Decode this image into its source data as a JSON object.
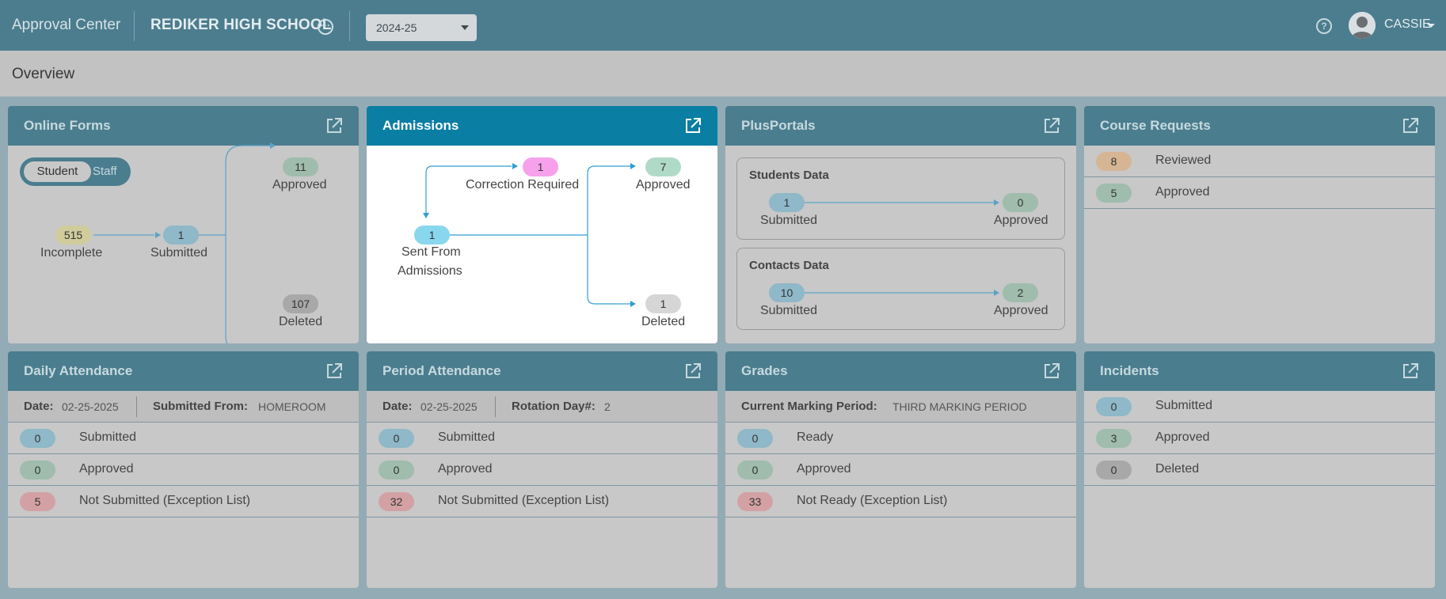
{
  "header": {
    "app_title": "Approval Center",
    "school_name": "REDIKER HIGH SCHOOL",
    "school_year": "2024-25",
    "user_name": "CASSIE",
    "icons": [
      "more-icon",
      "help-icon",
      "avatar",
      "chevron-down-icon",
      "external-link-icon"
    ]
  },
  "page": {
    "title": "Overview"
  },
  "colors": {
    "header_bg": "#4b7d8e",
    "active_header": "#0a7ea3",
    "pill_blue": "#8fb8c8",
    "pill_green": "#9fbcad",
    "pill_gray": "#a8a8a8",
    "pill_red": "#d3a1a4",
    "pill_orange": "#d5b594",
    "pill_yellow": "#d0cc9c",
    "pill_pink": "#f7a1ec",
    "pill_cyan": "#89d7ee",
    "pill_mint": "#b0dac8"
  },
  "online_forms": {
    "title": "Online Forms",
    "toggle_on": "Student",
    "toggle_off": "Staff",
    "incomplete": {
      "count": "515",
      "label": "Incomplete"
    },
    "submitted": {
      "count": "1",
      "label": "Submitted"
    },
    "approved": {
      "count": "11",
      "label": "Approved"
    },
    "deleted": {
      "count": "107",
      "label": "Deleted"
    }
  },
  "admissions": {
    "title": "Admissions",
    "correction": {
      "count": "1",
      "label": "Correction Required"
    },
    "sent": {
      "count": "1",
      "label_line1": "Sent From",
      "label_line2": "Admissions"
    },
    "approved": {
      "count": "7",
      "label": "Approved"
    },
    "deleted": {
      "count": "1",
      "label": "Deleted"
    }
  },
  "plusportals": {
    "title": "PlusPortals",
    "students": {
      "title": "Students Data",
      "submitted": "1",
      "submitted_label": "Submitted",
      "approved": "0",
      "approved_label": "Approved"
    },
    "contacts": {
      "title": "Contacts Data",
      "submitted": "10",
      "submitted_label": "Submitted",
      "approved": "2",
      "approved_label": "Approved"
    }
  },
  "course_requests": {
    "title": "Course Requests",
    "rows": [
      {
        "count": "8",
        "label": "Reviewed"
      },
      {
        "count": "5",
        "label": "Approved"
      }
    ]
  },
  "daily_attendance": {
    "title": "Daily Attendance",
    "date_key": "Date:",
    "date_val": "02-25-2025",
    "from_key": "Submitted From:",
    "from_val": "HOMEROOM",
    "rows": [
      {
        "count": "0",
        "label": "Submitted"
      },
      {
        "count": "0",
        "label": "Approved"
      },
      {
        "count": "5",
        "label": "Not Submitted (Exception List)"
      }
    ]
  },
  "period_attendance": {
    "title": "Period Attendance",
    "date_key": "Date:",
    "date_val": "02-25-2025",
    "rot_key": "Rotation Day#:",
    "rot_val": "2",
    "rows": [
      {
        "count": "0",
        "label": "Submitted"
      },
      {
        "count": "0",
        "label": "Approved"
      },
      {
        "count": "32",
        "label": "Not Submitted (Exception List)"
      }
    ]
  },
  "grades": {
    "title": "Grades",
    "mp_key": "Current Marking Period:",
    "mp_val": "THIRD MARKING PERIOD",
    "rows": [
      {
        "count": "0",
        "label": "Ready"
      },
      {
        "count": "0",
        "label": "Approved"
      },
      {
        "count": "33",
        "label": "Not Ready (Exception List)"
      }
    ]
  },
  "incidents": {
    "title": "Incidents",
    "rows": [
      {
        "count": "0",
        "label": "Submitted"
      },
      {
        "count": "3",
        "label": "Approved"
      },
      {
        "count": "0",
        "label": "Deleted"
      }
    ]
  }
}
